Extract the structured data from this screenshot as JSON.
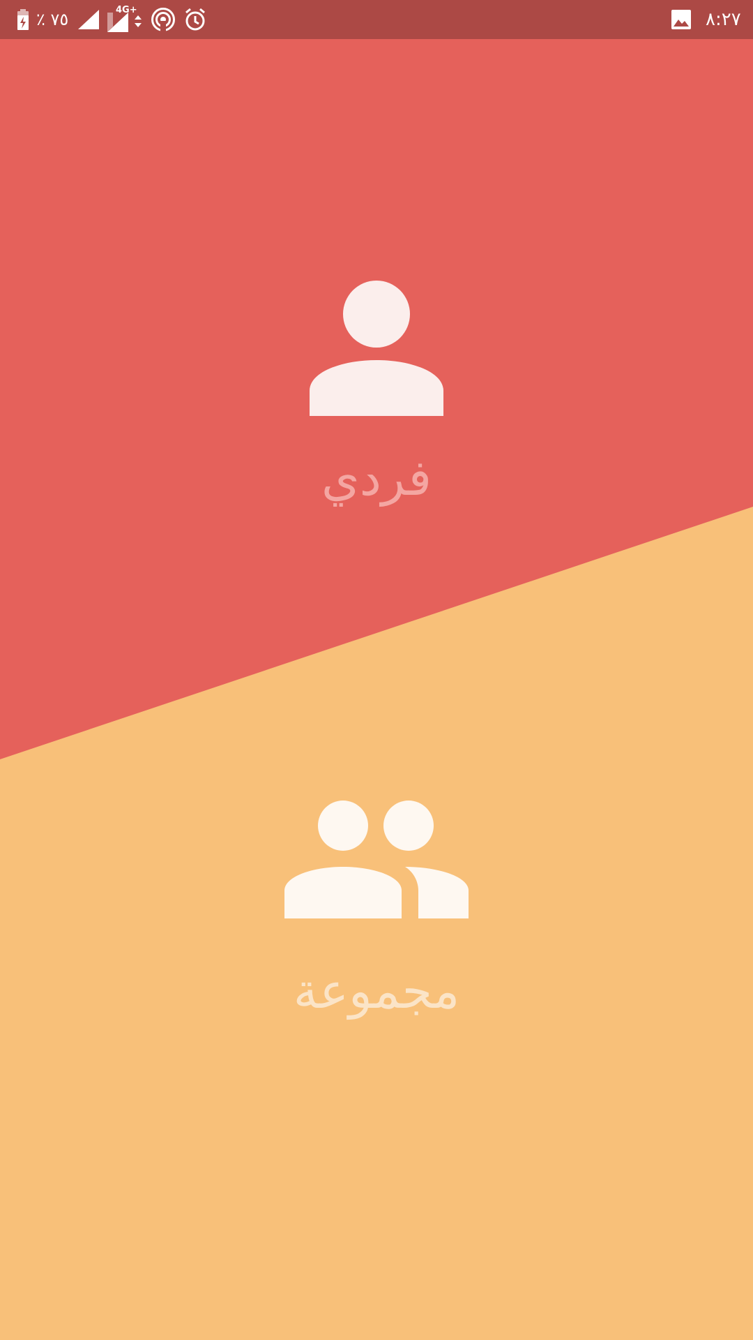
{
  "status_bar": {
    "battery_percent": "٪ ٧٥",
    "network_type": "4G+",
    "time": "٨:٢٧",
    "icons": [
      "battery-charging-icon",
      "signal-icon",
      "signal-4g-icon",
      "hotspot-icon",
      "alarm-icon",
      "image-notification-icon"
    ]
  },
  "options": [
    {
      "label": "فردي",
      "icon": "person-icon"
    },
    {
      "label": "مجموعة",
      "icon": "group-icon"
    }
  ],
  "colors": {
    "status_bar": "#ac4945",
    "individual_bg": "#e5615b",
    "group_bg": "#f8c079",
    "individual_icon": "#fbeeec",
    "individual_label": "#f4a6a2",
    "group_icon": "#fef8f1",
    "group_label": "#fbe4c7"
  }
}
